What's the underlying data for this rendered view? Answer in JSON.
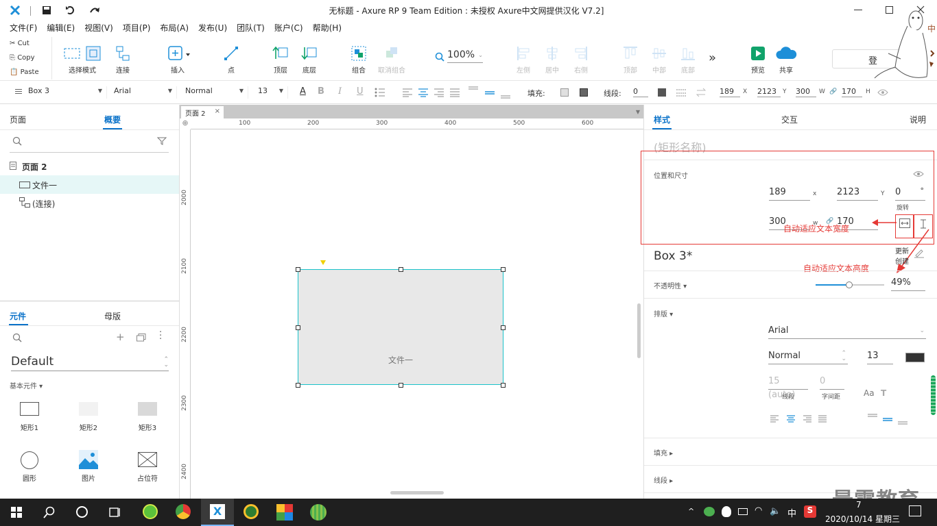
{
  "window": {
    "title": "无标题 - Axure RP 9 Team Edition : 未授权    Axure中文网提供汉化 V7.2]"
  },
  "menu": [
    "文件(F)",
    "编辑(E)",
    "视图(V)",
    "项目(P)",
    "布局(A)",
    "发布(U)",
    "团队(T)",
    "账户(C)",
    "帮助(H)"
  ],
  "clipboard": {
    "cut": "Cut",
    "copy": "Copy",
    "paste": "Paste"
  },
  "toolbar": {
    "select_mode": "选择模式",
    "connect": "连接",
    "insert": "插入",
    "point": "点",
    "top_layer": "顶层",
    "bottom_layer": "底层",
    "group": "组合",
    "ungroup": "取消组合",
    "zoom": "100%",
    "left": "左侧",
    "center": "居中",
    "right": "右侧",
    "top": "顶部",
    "middle": "中部",
    "bottom": "底部",
    "more": "»",
    "preview": "预览",
    "share": "共享",
    "login": "登"
  },
  "format": {
    "widget_name": "Box 3",
    "font": "Arial",
    "style": "Normal",
    "size": "13",
    "fill_label": "填充:",
    "stroke_label": "线段:",
    "stroke_value": "0",
    "x": "189",
    "x_label": "X",
    "y": "2123",
    "y_label": "Y",
    "w": "300",
    "w_label": "W",
    "h": "170",
    "h_label": "H"
  },
  "left_panel": {
    "tabs": {
      "pages": "页面",
      "outline": "概要"
    },
    "tree": {
      "page": "页面 2",
      "items": [
        "文件一",
        "(连接)"
      ]
    },
    "lib_tabs": {
      "widgets": "元件",
      "masters": "母版"
    },
    "library": "Default",
    "category": "基本元件 ▾",
    "widgets": [
      "矩形1",
      "矩形2",
      "矩形3",
      "圆形",
      "图片",
      "占位符"
    ]
  },
  "canvas": {
    "tab_label": "页面 2",
    "ruler_top": [
      "100",
      "200",
      "300",
      "400",
      "500",
      "600"
    ],
    "ruler_left": [
      "2000",
      "2100",
      "2200",
      "2300",
      "2400"
    ],
    "box_text": "文件一"
  },
  "right_panel": {
    "tabs": {
      "style": "样式",
      "interact": "交互",
      "notes": "说明"
    },
    "shape_name_placeholder": "(矩形名称)",
    "pos_size_title": "位置和尺寸",
    "x": "189",
    "x_label": "x",
    "y": "2123",
    "y_label": "Y",
    "rotation": "0",
    "rotation_unit": "°",
    "rotation_label": "旋转",
    "w": "300",
    "w_label": "w",
    "h": "170",
    "annotation_width": "自动适应文本宽度",
    "annotation_height": "自动适应文本高度",
    "style_name": "Box 3*",
    "update_label": "更新",
    "create_label": "创建",
    "opacity_label": "不透明性 ▾",
    "opacity_value": "49%",
    "opacity_fraction": 0.49,
    "typography_label": "排版 ▾",
    "font": "Arial",
    "font_style": "Normal",
    "font_size": "13",
    "line_spacing": "15 (auto)",
    "line_spacing_label": "线段",
    "char_spacing": "0",
    "char_spacing_label": "字间距",
    "fill_label": "填充 ▸",
    "stroke_label": "线段 ▸"
  },
  "watermark": "最需教育",
  "taskbar": {
    "datetime": "2020/10/14 星期三",
    "time_partial": "7",
    "ime": "中"
  },
  "colors": {
    "accent": "#0a72c9",
    "selection": "#19c2c9",
    "annotation": "#e53935",
    "taskbar": "#1f1f1f"
  }
}
